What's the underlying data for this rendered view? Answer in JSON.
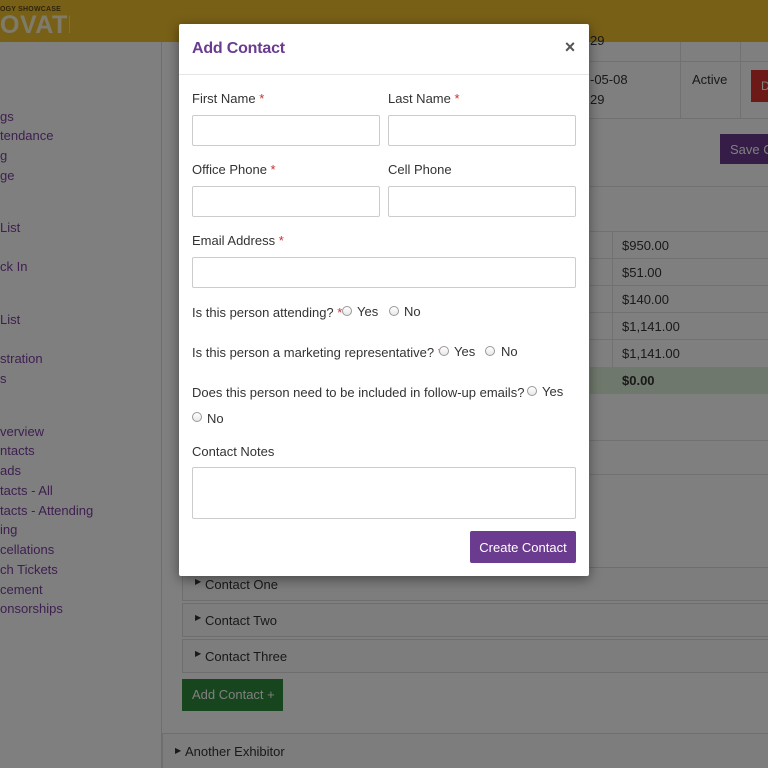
{
  "brand": {
    "small_text": "OGY SHOWCASE",
    "logo_text": "OVATE"
  },
  "sidebar": {
    "items": [
      {
        "label": "gs"
      },
      {
        "label": "tendance"
      },
      {
        "label": "g"
      },
      {
        "label": "ge"
      },
      {
        "label": "List"
      },
      {
        "label": "ck In"
      },
      {
        "label": "List"
      },
      {
        "label": "stration"
      },
      {
        "label": "s"
      },
      {
        "label": "verview"
      },
      {
        "label": "ntacts"
      },
      {
        "label": "ads"
      },
      {
        "label": "tacts - All"
      },
      {
        "label": "tacts - Attending"
      },
      {
        "label": "ing"
      },
      {
        "label": "cellations"
      },
      {
        "label": "ch Tickets"
      },
      {
        "label": "cement"
      },
      {
        "label": "onsorships"
      }
    ]
  },
  "background": {
    "top_time": "29",
    "row_date": "-05-08",
    "row_time": "29",
    "row_status": "Active",
    "delete_label": "D",
    "save_label": "Save C",
    "amounts": [
      "$950.00",
      "$51.00",
      "$140.00",
      "$1,141.00",
      "$1,141.00"
    ],
    "total_amount": "$0.00",
    "contacts": [
      "Contact One",
      "Contact Two",
      "Contact Three"
    ],
    "add_contact_label": "Add Contact +",
    "another_exhibitor_label": "Another Exhibitor"
  },
  "modal": {
    "title": "Add Contact",
    "close_symbol": "×",
    "required_mark": "*",
    "fields": {
      "first_name": {
        "label": "First Name",
        "value": ""
      },
      "last_name": {
        "label": "Last Name",
        "value": ""
      },
      "office_phone": {
        "label": "Office Phone",
        "value": ""
      },
      "cell_phone": {
        "label": "Cell Phone",
        "value": ""
      },
      "email": {
        "label": "Email Address",
        "value": ""
      },
      "notes": {
        "label": "Contact Notes",
        "value": ""
      }
    },
    "questions": {
      "attending": {
        "label": "Is this person attending?",
        "yes": "Yes",
        "no": "No"
      },
      "marketing": {
        "label": "Is this person a marketing representative?",
        "yes": "Yes",
        "no": "No"
      },
      "followup": {
        "label": "Does this person need to be included in follow-up emails?",
        "yes": "Yes",
        "no": "No"
      }
    },
    "submit_label": "Create Contact"
  },
  "colors": {
    "brand_yellow": "#f2c12e",
    "accent_purple": "#6b3b8f",
    "required_red": "#c9302c",
    "success_green": "#2e8b3a",
    "danger_red": "#d9322f"
  }
}
